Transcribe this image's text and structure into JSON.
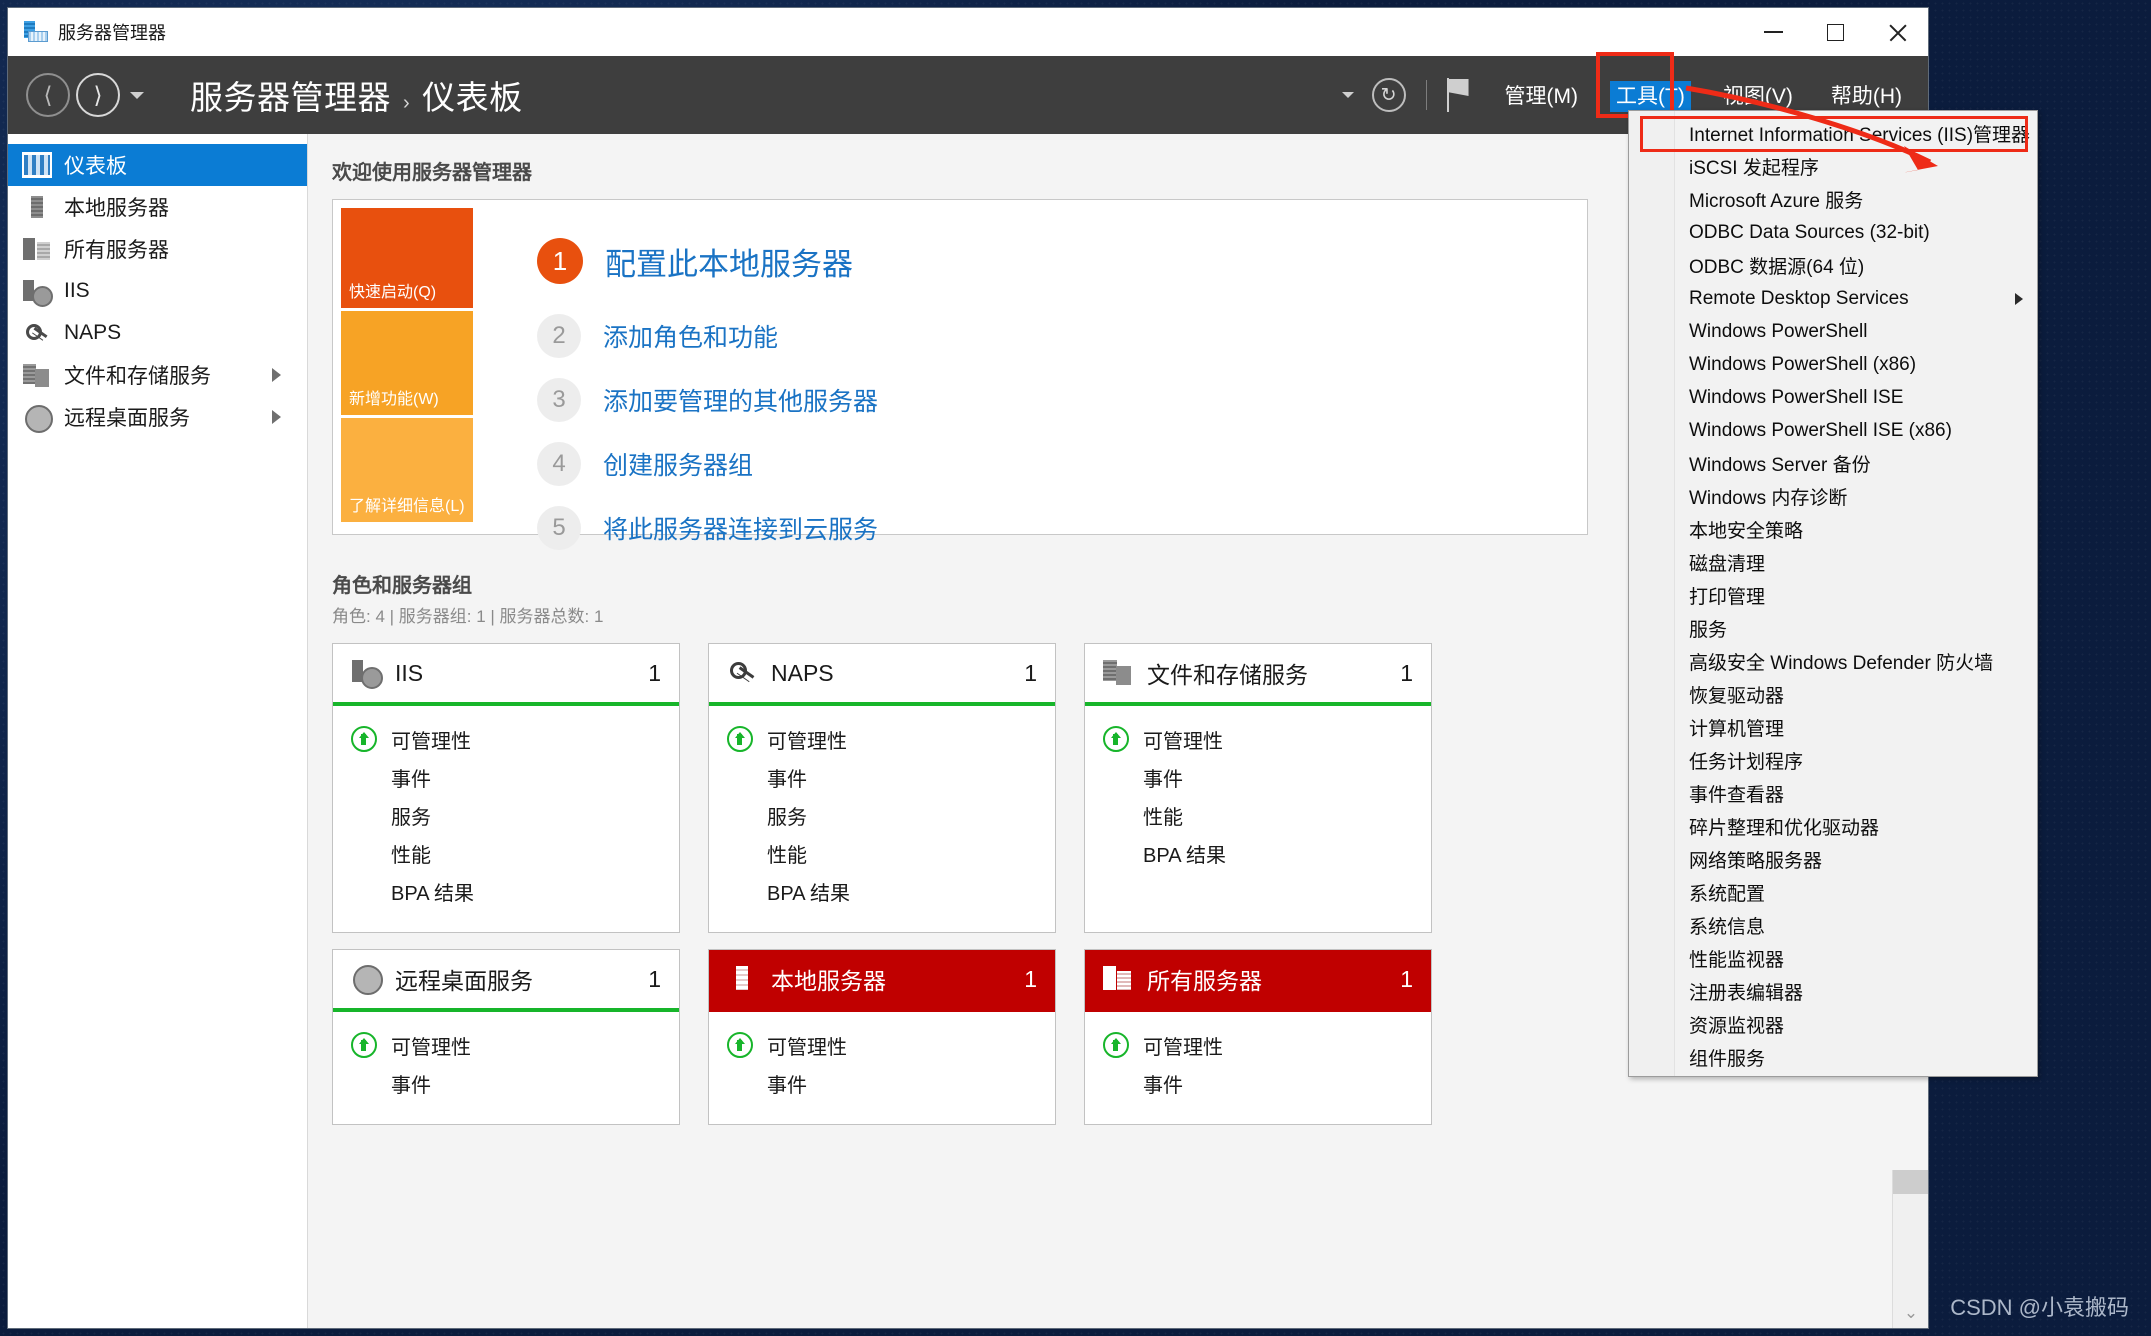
{
  "window": {
    "title": "服务器管理器",
    "app_icon": "server-manager-icon",
    "minimize": "—",
    "maximize": "▢",
    "close": "✕"
  },
  "commandbar": {
    "back_icon": "back-arrow-icon",
    "forward_icon": "forward-arrow-icon",
    "history_caret": "chevron-down-icon",
    "breadcrumb_root": "服务器管理器",
    "breadcrumb_sep": "›",
    "breadcrumb_current": "仪表板",
    "refresh_icon": "refresh-icon",
    "flag_icon": "notifications-flag-icon",
    "menus": [
      {
        "label": "管理(M)",
        "active": false
      },
      {
        "label": "工具(T)",
        "active": true
      },
      {
        "label": "视图(V)",
        "active": false
      },
      {
        "label": "帮助(H)",
        "active": false
      }
    ]
  },
  "sidebar": {
    "items": [
      {
        "label": "仪表板",
        "icon": "dashboard-icon",
        "selected": true,
        "expandable": false
      },
      {
        "label": "本地服务器",
        "icon": "server-icon",
        "selected": false,
        "expandable": false
      },
      {
        "label": "所有服务器",
        "icon": "servers-icon",
        "selected": false,
        "expandable": false
      },
      {
        "label": "IIS",
        "icon": "iis-icon",
        "selected": false,
        "expandable": false
      },
      {
        "label": "NAPS",
        "icon": "naps-key-icon",
        "selected": false,
        "expandable": false
      },
      {
        "label": "文件和存储服务",
        "icon": "file-storage-icon",
        "selected": false,
        "expandable": true
      },
      {
        "label": "远程桌面服务",
        "icon": "remote-desktop-icon",
        "selected": false,
        "expandable": true
      }
    ]
  },
  "welcome": {
    "heading": "欢迎使用服务器管理器",
    "quick_blocks": [
      {
        "label": "快速启动(Q)",
        "color": "#e8500e"
      },
      {
        "label": "新增功能(W)",
        "color": "#f7a325"
      },
      {
        "label": "了解详细信息(L)",
        "color": "#fbb040"
      }
    ],
    "steps": [
      {
        "num": "1",
        "text": "配置此本地服务器",
        "primary": true
      },
      {
        "num": "2",
        "text": "添加角色和功能",
        "primary": false
      },
      {
        "num": "3",
        "text": "添加要管理的其他服务器",
        "primary": false
      },
      {
        "num": "4",
        "text": "创建服务器组",
        "primary": false
      },
      {
        "num": "5",
        "text": "将此服务器连接到云服务",
        "primary": false
      }
    ]
  },
  "roles": {
    "title": "角色和服务器组",
    "subtitle": "角色: 4 | 服务器组: 1 | 服务器总数: 1",
    "cards": [
      {
        "name": "IIS",
        "count": "1",
        "icon": "iis-icon",
        "alert": false,
        "rows": [
          {
            "label": "可管理性",
            "badge": true
          },
          {
            "label": "事件",
            "badge": false
          },
          {
            "label": "服务",
            "badge": false
          },
          {
            "label": "性能",
            "badge": false
          },
          {
            "label": "BPA 结果",
            "badge": false
          }
        ]
      },
      {
        "name": "NAPS",
        "count": "1",
        "icon": "naps-key-icon",
        "alert": false,
        "rows": [
          {
            "label": "可管理性",
            "badge": true
          },
          {
            "label": "事件",
            "badge": false
          },
          {
            "label": "服务",
            "badge": false
          },
          {
            "label": "性能",
            "badge": false
          },
          {
            "label": "BPA 结果",
            "badge": false
          }
        ]
      },
      {
        "name": "文件和存储服务",
        "count": "1",
        "icon": "file-storage-icon",
        "alert": false,
        "rows": [
          {
            "label": "可管理性",
            "badge": true
          },
          {
            "label": "事件",
            "badge": false
          },
          {
            "label": "性能",
            "badge": false
          },
          {
            "label": "BPA 结果",
            "badge": false
          }
        ]
      },
      {
        "name": "远程桌面服务",
        "count": "1",
        "icon": "remote-desktop-icon",
        "alert": false,
        "rows": [
          {
            "label": "可管理性",
            "badge": true
          },
          {
            "label": "事件",
            "badge": false
          }
        ]
      },
      {
        "name": "本地服务器",
        "count": "1",
        "icon": "server-icon",
        "alert": true,
        "rows": [
          {
            "label": "可管理性",
            "badge": true
          },
          {
            "label": "事件",
            "badge": false
          }
        ]
      },
      {
        "name": "所有服务器",
        "count": "1",
        "icon": "servers-icon",
        "alert": true,
        "rows": [
          {
            "label": "可管理性",
            "badge": true
          },
          {
            "label": "事件",
            "badge": false
          }
        ]
      }
    ]
  },
  "tools_menu": {
    "items": [
      {
        "label": "Internet Information Services (IIS)管理器",
        "highlighted": true,
        "submenu": false
      },
      {
        "label": "iSCSI 发起程序",
        "highlighted": false,
        "submenu": false
      },
      {
        "label": "Microsoft Azure 服务",
        "highlighted": false,
        "submenu": false
      },
      {
        "label": "ODBC Data Sources (32-bit)",
        "highlighted": false,
        "submenu": false
      },
      {
        "label": "ODBC 数据源(64 位)",
        "highlighted": false,
        "submenu": false
      },
      {
        "label": "Remote Desktop Services",
        "highlighted": false,
        "submenu": true
      },
      {
        "label": "Windows PowerShell",
        "highlighted": false,
        "submenu": false
      },
      {
        "label": "Windows PowerShell (x86)",
        "highlighted": false,
        "submenu": false
      },
      {
        "label": "Windows PowerShell ISE",
        "highlighted": false,
        "submenu": false
      },
      {
        "label": "Windows PowerShell ISE (x86)",
        "highlighted": false,
        "submenu": false
      },
      {
        "label": "Windows Server 备份",
        "highlighted": false,
        "submenu": false
      },
      {
        "label": "Windows 内存诊断",
        "highlighted": false,
        "submenu": false
      },
      {
        "label": "本地安全策略",
        "highlighted": false,
        "submenu": false
      },
      {
        "label": "磁盘清理",
        "highlighted": false,
        "submenu": false
      },
      {
        "label": "打印管理",
        "highlighted": false,
        "submenu": false
      },
      {
        "label": "服务",
        "highlighted": false,
        "submenu": false
      },
      {
        "label": "高级安全 Windows Defender 防火墙",
        "highlighted": false,
        "submenu": false
      },
      {
        "label": "恢复驱动器",
        "highlighted": false,
        "submenu": false
      },
      {
        "label": "计算机管理",
        "highlighted": false,
        "submenu": false
      },
      {
        "label": "任务计划程序",
        "highlighted": false,
        "submenu": false
      },
      {
        "label": "事件查看器",
        "highlighted": false,
        "submenu": false
      },
      {
        "label": "碎片整理和优化驱动器",
        "highlighted": false,
        "submenu": false
      },
      {
        "label": "网络策略服务器",
        "highlighted": false,
        "submenu": false
      },
      {
        "label": "系统配置",
        "highlighted": false,
        "submenu": false
      },
      {
        "label": "系统信息",
        "highlighted": false,
        "submenu": false
      },
      {
        "label": "性能监视器",
        "highlighted": false,
        "submenu": false
      },
      {
        "label": "注册表编辑器",
        "highlighted": false,
        "submenu": false
      },
      {
        "label": "资源监视器",
        "highlighted": false,
        "submenu": false
      },
      {
        "label": "组件服务",
        "highlighted": false,
        "submenu": false
      }
    ]
  },
  "annotations": {
    "highlight_color": "#ee2b17",
    "arrow_icon": "red-pointer-arrow"
  },
  "watermark": "CSDN @小袁搬码"
}
